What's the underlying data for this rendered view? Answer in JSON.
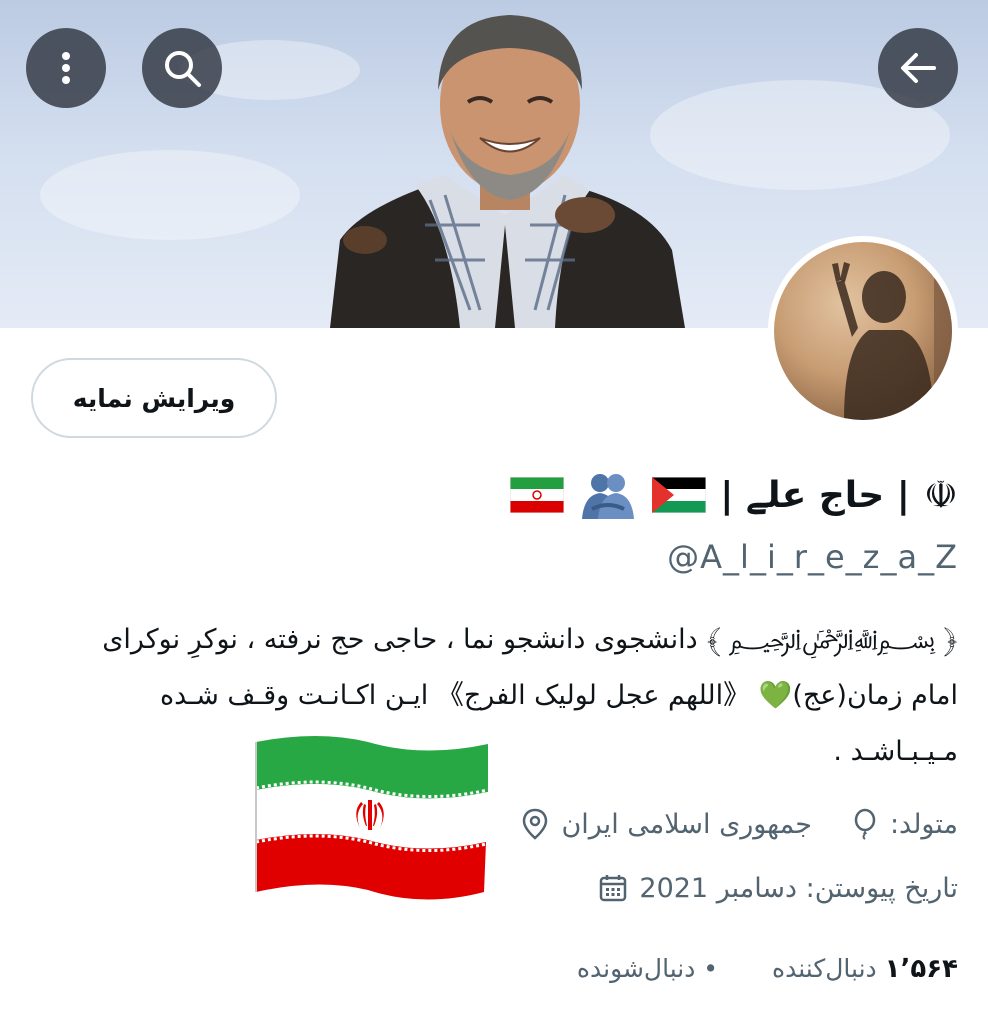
{
  "header": {
    "back_icon": "arrow-left-icon",
    "search_icon": "search-icon",
    "more_icon": "more-vertical-icon"
  },
  "profile": {
    "edit_button": "ویرایش نمایه",
    "emblem": "☫",
    "name": "| حاج علے |",
    "badges": [
      "palestine-flag",
      "people-hugging-emoji",
      "iran-flag"
    ],
    "handle": "@A_l_i_r_e_z_a_Z",
    "bio": {
      "line1": "﴿ ﷽ ﴾ دانشجوی دانشجو نما ، حاجی حج نرفته ، نوکرِ نوکرای",
      "line2_a": "امام زمان(عج)",
      "line2_heart": "💚",
      "line2_b": "《اللهم عجل لولیک الفرج》 ایـن اکـانـت وقـف شـده",
      "line3": "مـیـبـاشـد ."
    },
    "location": "جمهوری اسلامی ایران",
    "born_label": "متولد:",
    "joined": "تاریخ پیوستن: دسامبر 2021",
    "following_count": "",
    "following_label": "• دنبال‌شونده",
    "followers_count": "۱٬۵۶۴",
    "followers_label": "دنبال‌کننده"
  },
  "colors": {
    "primary_text": "#0f1419",
    "secondary_text": "#536471",
    "border": "#cfd9de",
    "iran_green": "#239f40",
    "iran_red": "#da0000"
  }
}
